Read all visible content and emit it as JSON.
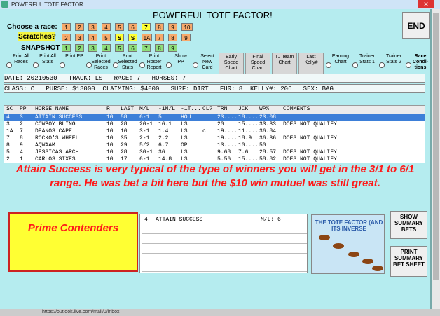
{
  "window": {
    "title": "POWERFUL TOTE FACTOR",
    "close": "✕"
  },
  "app": {
    "title": "POWERFUL TOTE FACTOR!",
    "end_button": "END"
  },
  "race_select": {
    "label": "Choose a race:",
    "races": [
      "1",
      "2",
      "3",
      "4",
      "5",
      "6",
      "7",
      "8",
      "9",
      "10"
    ],
    "selected": "7"
  },
  "scratches": {
    "label": "Scratches?",
    "items": [
      "2",
      "3",
      "4",
      "5",
      "S",
      "S",
      "1A",
      "7",
      "8",
      "9"
    ]
  },
  "snapshot": {
    "label": "SNAPSHOT",
    "items": [
      "1",
      "2",
      "3",
      "4",
      "5",
      "6",
      "7",
      "8",
      "9"
    ]
  },
  "options": [
    {
      "label": "Print All Races",
      "type": "radio"
    },
    {
      "label": "Print All Stats",
      "type": "radio"
    },
    {
      "label": "Print PP",
      "type": "radio"
    },
    {
      "label": "Print Selected Races",
      "type": "radio"
    },
    {
      "label": "Print Selected Stats",
      "type": "radio"
    },
    {
      "label": "Print Roster Report",
      "type": "radio"
    },
    {
      "label": "Show PP",
      "type": "radio"
    },
    {
      "label": "Select New Card",
      "type": "radio"
    },
    {
      "label": "Early Speed Chart",
      "type": "button"
    },
    {
      "label": "Final Speed Chart",
      "type": "button"
    },
    {
      "label": "TJ Team Chart",
      "type": "button"
    },
    {
      "label": "Last Kelly#",
      "type": "button"
    },
    {
      "label": "Earning Chart",
      "type": "radio"
    },
    {
      "label": "Trainer Stats 1",
      "type": "radio"
    },
    {
      "label": "Trainer Stats 2",
      "type": "radio"
    },
    {
      "label": "Race Condi- tions",
      "type": "radio-bold"
    }
  ],
  "info1": "DATE: 20210530   TRACK: LS   RACE: 7   HORSES: 7",
  "info2": "CLASS: C   PURSE: $13000  CLAIMING: $4000   SURF: DIRT   FUR: 8  KELLY#: 206   SEX: BAG",
  "table": {
    "headers": [
      "SC",
      "PP",
      "HORSE NAME",
      "R",
      "LAST",
      "M/L",
      "-1M/L",
      "-1T...",
      "CL?",
      "TRN",
      "JCK",
      "WP%",
      "COMMENTS"
    ],
    "rows": [
      [
        "4",
        "3",
        "ATTAIN SUCCESS",
        "10",
        "58",
        "6-1",
        "5",
        "HOU",
        "",
        "23....",
        "18....",
        "23.08",
        ""
      ],
      [
        "3",
        "2",
        "COWBOY BLING",
        "10",
        "28",
        "20-1",
        "16.1",
        "LS",
        "",
        "20",
        "15....",
        "33.33",
        "DOES NOT QUALIFY"
      ],
      [
        "1A",
        "7",
        "DEANOS CAPE",
        "10",
        "10",
        "3-1",
        "1.4",
        "LS",
        "c",
        "19....",
        "11....",
        "36.84",
        ""
      ],
      [
        "7",
        "8",
        "ROCKO'S WHEEL",
        "10",
        "35",
        "2-1",
        "2.2",
        "LS",
        "",
        "19....",
        "18.9",
        "36.36",
        "DOES NOT QUALIFY"
      ],
      [
        "8",
        "9",
        "AQWAAM",
        "10",
        "29",
        "5/2",
        "6.7",
        "OP",
        "",
        "13....",
        "10....",
        "50",
        ""
      ],
      [
        "5",
        "4",
        "JESSICAS ARCH",
        "10",
        "28",
        "30-1",
        "36",
        "LS",
        "",
        "9.68",
        "7.6",
        "28.57",
        "DOES NOT QUALIFY"
      ],
      [
        "2",
        "1",
        "CARLOS SIXES",
        "10",
        "17",
        "6-1",
        "14.8",
        "LS",
        "",
        "5.56",
        "15....",
        "58.82",
        "DOES NOT QUALIFY"
      ]
    ]
  },
  "annotation": "Attain Success is very typical of the type of winners you will get in the 3/1 to 6/1 range.  He was bet a bit here but the $10 win mutuel was still great.",
  "prime": {
    "label": "Prime Contenders",
    "line1_num": "4",
    "line1_name": "ATTAIN SUCCESS",
    "line1_ml": "M/L: 6"
  },
  "logo": {
    "text": "THE TOTE FACTOR (AND ITS INVERSE"
  },
  "buttons": {
    "show_summary": "SHOW SUMMARY BETS",
    "print_summary": "PRINT SUMMARY BET SHEET"
  },
  "taskbar": "https://outlook.live.com/mail/0/inbox"
}
